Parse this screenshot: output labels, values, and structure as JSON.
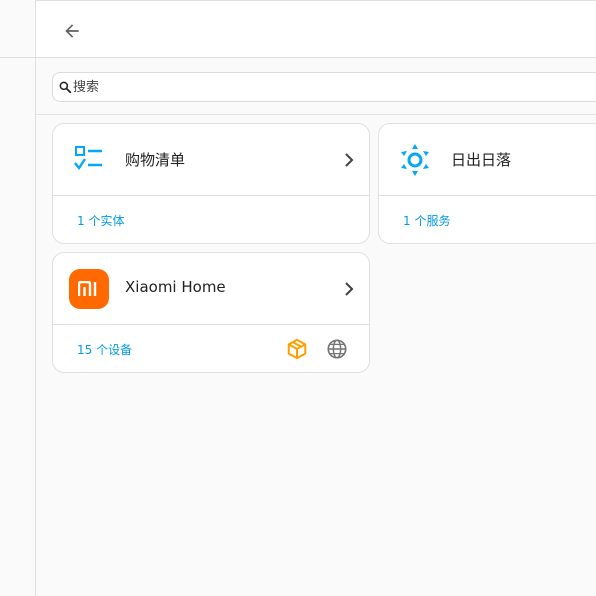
{
  "header": {
    "back_label": "←"
  },
  "search": {
    "placeholder": "搜索",
    "value": ""
  },
  "cards": [
    {
      "title": "购物清单",
      "link": "1 个实体",
      "icon": "checklist-icon"
    },
    {
      "title": "日出日落",
      "link": "1 个服务",
      "icon": "sun-icon"
    },
    {
      "title": "Xiaomi Home",
      "link": "15 个设备",
      "icon": "xiaomi-logo-icon",
      "footer_icons": [
        "custom-integration-icon",
        "cloud-globe-icon"
      ]
    }
  ],
  "colors": {
    "accent": "#039be5",
    "xiaomi": "#ff6900",
    "custom": "#ffa000",
    "icon_blue": "#03a9f4"
  }
}
